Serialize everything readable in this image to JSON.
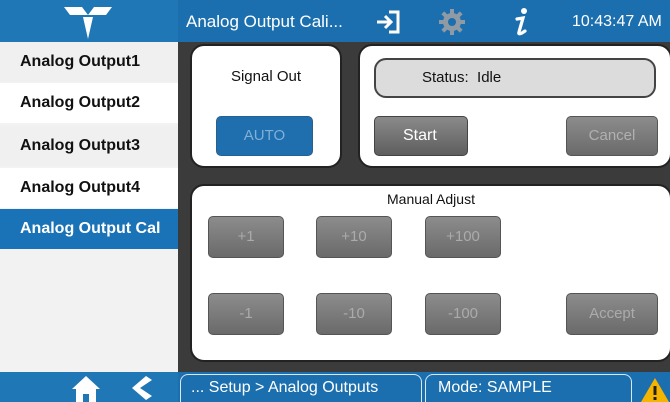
{
  "header": {
    "title": "Analog Output Cali...",
    "clock": "10:43:47 AM",
    "brand_color": "#1c6fae"
  },
  "sidebar": {
    "items": [
      {
        "label": "Analog Output1",
        "active": false
      },
      {
        "label": "Analog Output2",
        "active": false
      },
      {
        "label": "Analog Output3",
        "active": false
      },
      {
        "label": "Analog Output4",
        "active": false
      },
      {
        "label": "Analog Output Cal",
        "active": true
      }
    ]
  },
  "signal_panel": {
    "title": "Signal Out",
    "button_label": "AUTO"
  },
  "status_panel": {
    "status_text": "Status:  Idle",
    "start_label": "Start",
    "cancel_label": "Cancel"
  },
  "manual_panel": {
    "title": "Manual Adjust",
    "up_buttons": [
      "+1",
      "+10",
      "+100"
    ],
    "down_buttons": [
      "-1",
      "-10",
      "-100"
    ],
    "accept_label": "Accept"
  },
  "footer": {
    "breadcrumb": "... Setup > Analog Outputs",
    "mode": "Mode: SAMPLE"
  },
  "icons": {
    "logo": "teledyne-logo-icon",
    "login": "login-icon",
    "settings": "gear-icon",
    "info": "info-icon",
    "home": "home-icon",
    "back": "back-icon",
    "warning": "warning-icon"
  }
}
